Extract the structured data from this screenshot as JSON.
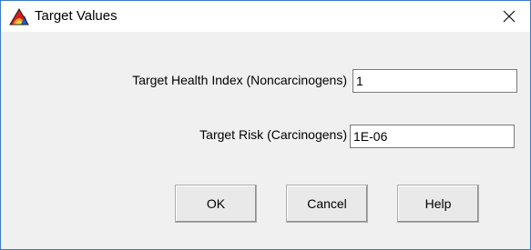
{
  "window": {
    "title": "Target Values",
    "icon": "app-icon",
    "close_glyph": "×"
  },
  "form": {
    "health_index_label": "Target Health Index (Noncarcinogens)",
    "health_index_value": "1",
    "risk_label": "Target Risk (Carcinogens)",
    "risk_value": "1E-06"
  },
  "buttons": {
    "ok": "OK",
    "cancel": "Cancel",
    "help": "Help"
  },
  "colors": {
    "border_accent": "#3c78c8",
    "dialog_bg": "#f0f0f0"
  }
}
